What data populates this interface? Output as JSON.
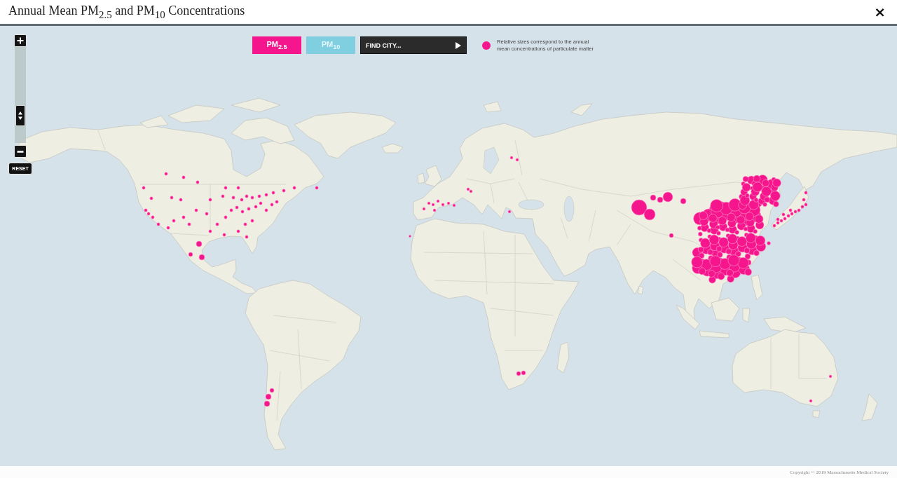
{
  "window": {
    "title": "Annual Mean PM$_{2.5}$ and PM$_{10}$ Concentrations",
    "close_label": "×"
  },
  "pollutant_tabs": [
    {
      "label": "PM$_{2.5}$",
      "selected": true
    },
    {
      "label": "PM$_{10}$",
      "selected": false
    }
  ],
  "city_finder": {
    "label": "FIND CITY..."
  },
  "legend": {
    "text": "Relative sizes correspond to the annual mean concentrations of particulate matter"
  },
  "zoom_control": {
    "level": 0.22,
    "reset_label": "RESET"
  },
  "footer": {
    "copyright": "Copyright © 2019 Massachusetts Medical Society"
  }
}
